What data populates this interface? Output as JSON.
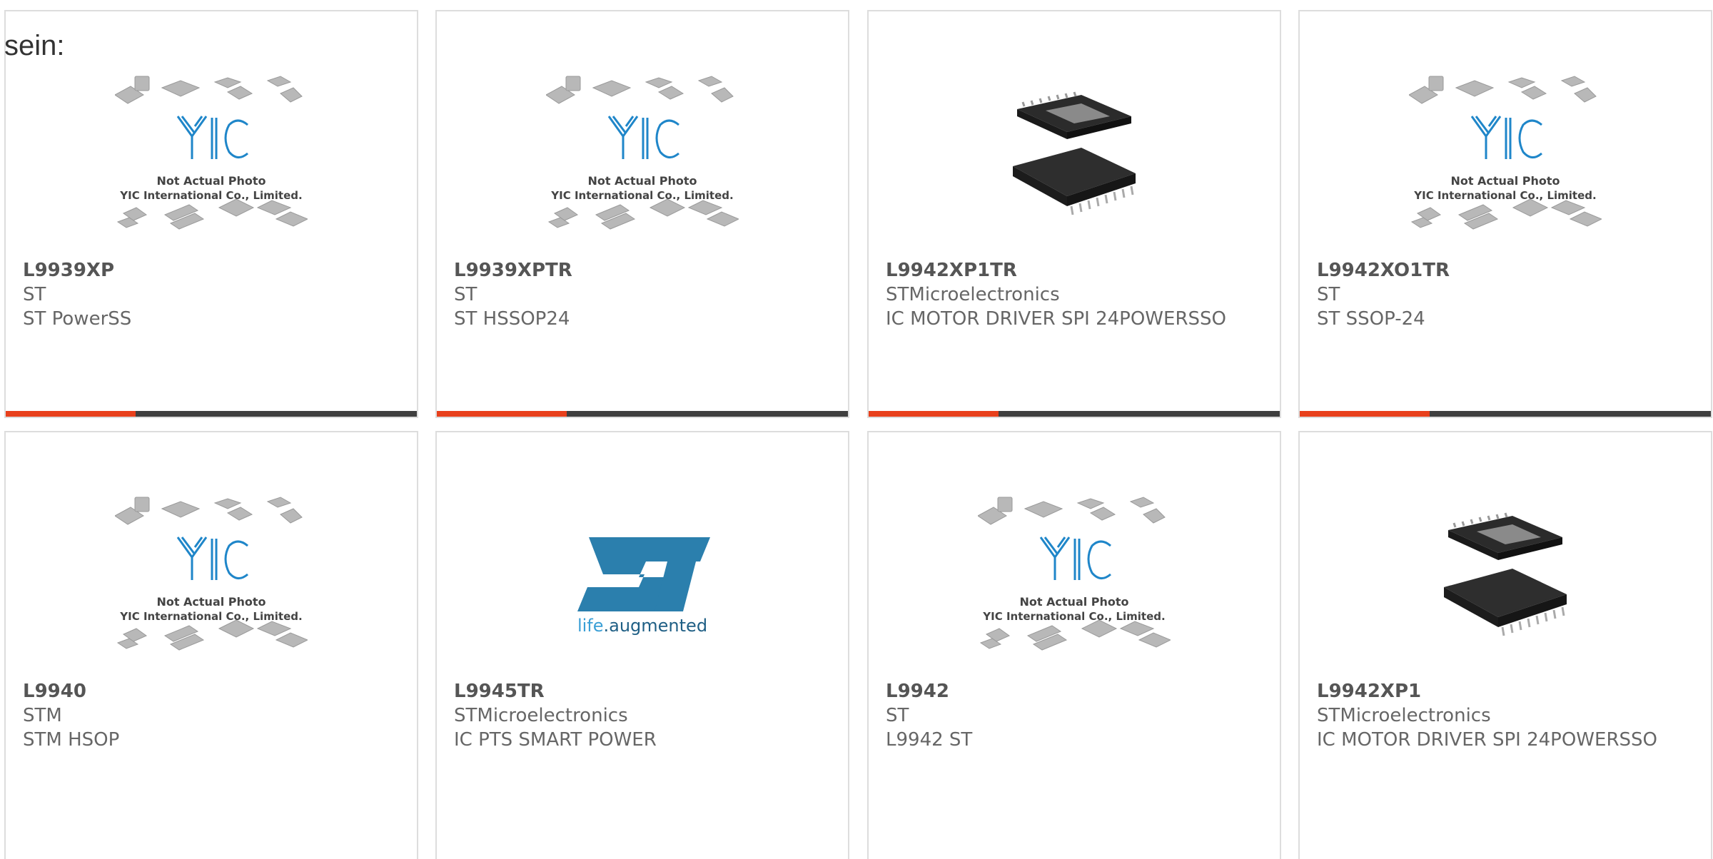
{
  "intro_text": "sein:",
  "colors": {
    "accent": "#e8401c",
    "bar": "#3f3f3f",
    "yic_blue": "#1f86c9",
    "st_blue": "#2b7fad"
  },
  "placeholder": {
    "logo": "YIC",
    "line1": "Not Actual Photo",
    "line2": "YIC International Co., Limited."
  },
  "st_logo": {
    "letters": "ST",
    "tagline_a": "life",
    "tagline_b": ".augmented"
  },
  "products": [
    {
      "part": "L9939XP",
      "manufacturer": "ST",
      "description": "ST PowerSS",
      "image": "placeholder"
    },
    {
      "part": "L9939XPTR",
      "manufacturer": "ST",
      "description": "ST HSSOP24",
      "image": "placeholder"
    },
    {
      "part": "L9942XP1TR",
      "manufacturer": "STMicroelectronics",
      "description": "IC MOTOR DRIVER SPI 24POWERSSO",
      "image": "chip-photo"
    },
    {
      "part": "L9942XO1TR",
      "manufacturer": "ST",
      "description": "ST SSOP-24",
      "image": "placeholder"
    },
    {
      "part": "L9940",
      "manufacturer": "STM",
      "description": "STM HSOP",
      "image": "placeholder"
    },
    {
      "part": "L9945TR",
      "manufacturer": "STMicroelectronics",
      "description": "IC PTS SMART POWER",
      "image": "st-logo"
    },
    {
      "part": "L9942",
      "manufacturer": "ST",
      "description": "L9942 ST",
      "image": "placeholder"
    },
    {
      "part": "L9942XP1",
      "manufacturer": "STMicroelectronics",
      "description": "IC MOTOR DRIVER SPI 24POWERSSO",
      "image": "chip-photo"
    }
  ]
}
